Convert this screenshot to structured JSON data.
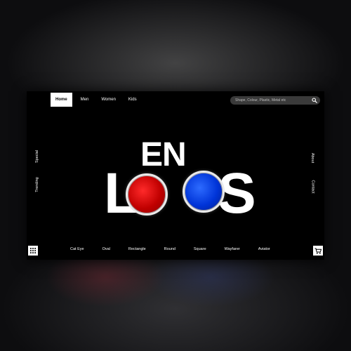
{
  "nav": {
    "items": [
      {
        "label": "Home",
        "active": true
      },
      {
        "label": "Men",
        "active": false
      },
      {
        "label": "Women",
        "active": false
      },
      {
        "label": "Kids",
        "active": false
      }
    ]
  },
  "search": {
    "placeholder": "Shape, Colour, Plastic, Metal etc",
    "icon": "search-icon"
  },
  "side_left": {
    "items": [
      "Special",
      "Trending"
    ]
  },
  "side_right": {
    "items": [
      "About",
      "Contact"
    ]
  },
  "logo": {
    "top_word": "EN",
    "letter_l": "L",
    "letter_s": "S",
    "lens_colors": {
      "left": "#d40000",
      "right": "#0040ff"
    }
  },
  "shapes": {
    "items": [
      "Cat Eye",
      "Oval",
      "Rectangle",
      "Round",
      "Square",
      "Wayfarer",
      "Aviator"
    ]
  },
  "buttons": {
    "menu_icon": "grid-icon",
    "cart_icon": "cart-icon"
  },
  "colors": {
    "screen_bg": "#000000",
    "text": "#ffffff",
    "search_bg": "#3a3a3a"
  }
}
